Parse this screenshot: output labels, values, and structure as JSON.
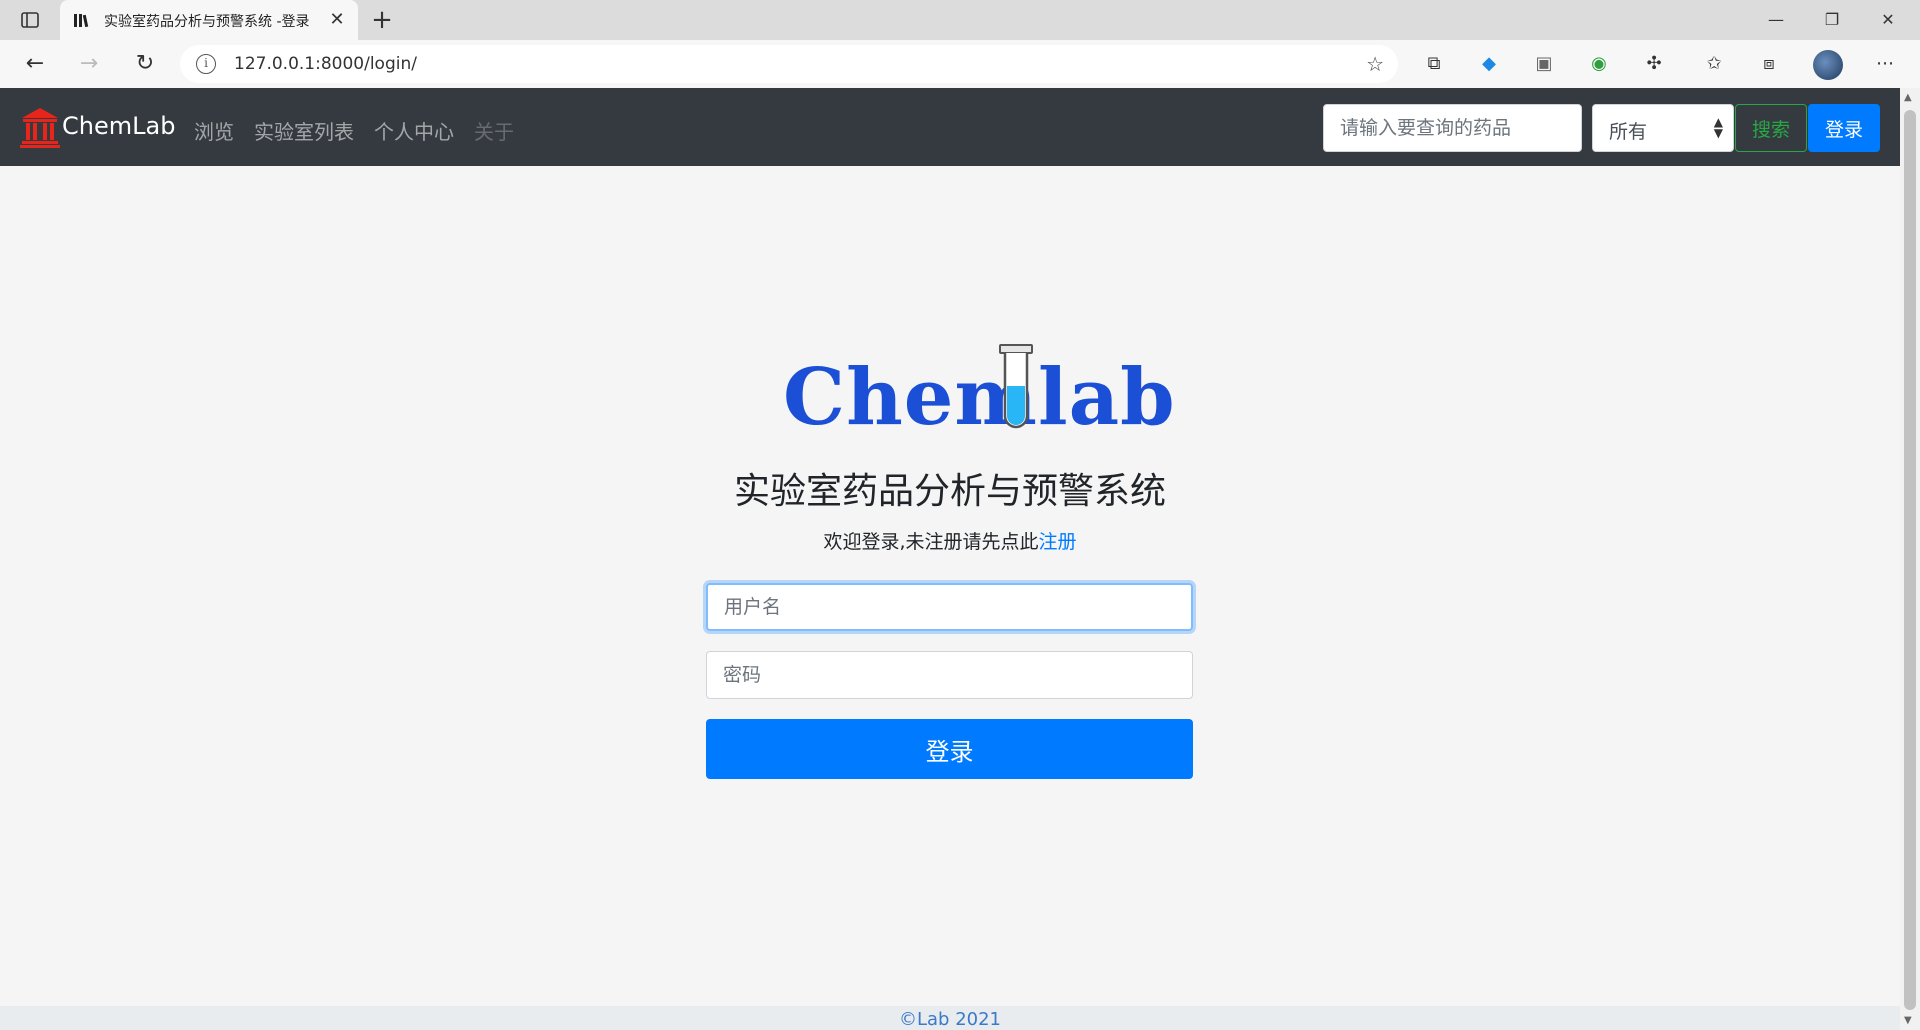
{
  "browser": {
    "tab_title": "实验室药品分析与预警系统 -登录",
    "url": "127.0.0.1:8000/login/",
    "new_tab": "+",
    "tab_close": "✕",
    "window_minimize": "—",
    "window_restore": "❐",
    "window_close": "✕"
  },
  "navbar": {
    "brand": "ChemLab",
    "links": [
      "浏览",
      "实验室列表",
      "个人中心",
      "关于"
    ],
    "search_placeholder": "请输入要查询的药品",
    "select_value": "所有",
    "search_button": "搜索",
    "login_button": "登录"
  },
  "login": {
    "logo_text": "Chemlab",
    "title": "实验室药品分析与预警系统",
    "welcome_prefix": "欢迎登录,未注册请先点此",
    "register_link": "注册",
    "username_placeholder": "用户名",
    "password_placeholder": "密码",
    "submit": "登录"
  },
  "footer": {
    "text": "©Lab 2021"
  },
  "colors": {
    "navbar_bg": "#343a40",
    "primary": "#007bff",
    "success": "#28a745",
    "logo_blue": "#1a4fd6"
  }
}
